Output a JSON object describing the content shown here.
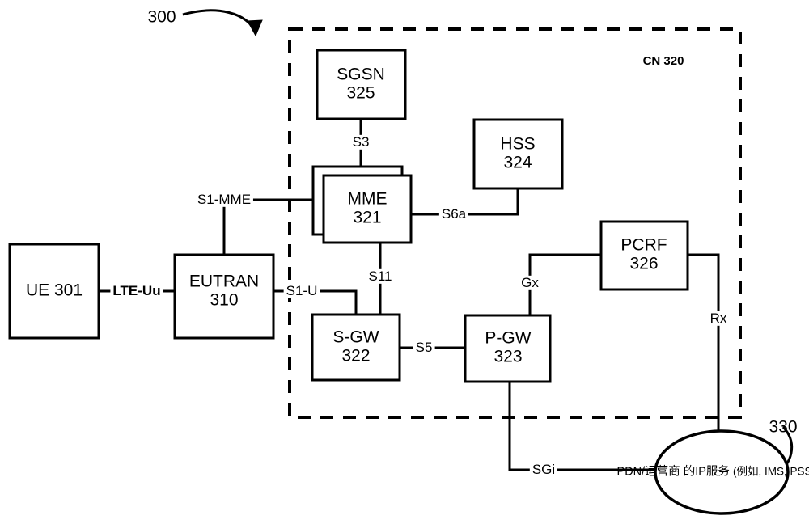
{
  "figure": {
    "ref_300": "300",
    "ref_330": "330",
    "cn_label": "CN 320"
  },
  "nodes": {
    "ue": {
      "name": "UE 301",
      "line1": "UE 301",
      "line2": ""
    },
    "eutran": {
      "name": "EUTRAN",
      "line1": "EUTRAN",
      "line2": "310"
    },
    "sgsn": {
      "name": "SGSN",
      "line1": "SGSN",
      "line2": "325"
    },
    "mme": {
      "name": "MME",
      "line1": "MME",
      "line2": "321"
    },
    "hss": {
      "name": "HSS",
      "line1": "HSS",
      "line2": "324"
    },
    "sgw": {
      "name": "S-GW",
      "line1": "S-GW",
      "line2": "322"
    },
    "pgw": {
      "name": "P-GW",
      "line1": "P-GW",
      "line2": "323"
    },
    "pcrf": {
      "name": "PCRF",
      "line1": "PCRF",
      "line2": "326"
    },
    "cloud": {
      "line1": "PDN/运营商",
      "line2": "的IP服务",
      "line3": "(例如, IMS, PSS等)"
    }
  },
  "interfaces": {
    "lte_uu": "LTE-Uu",
    "s1_mme": "S1-MME",
    "s1_u": "S1-U",
    "s3": "S3",
    "s5": "S5",
    "s6a": "S6a",
    "s11": "S11",
    "gx": "Gx",
    "rx": "Rx",
    "sgi": "SGi"
  },
  "colors": {
    "stroke": "#000000",
    "background": "#ffffff"
  }
}
